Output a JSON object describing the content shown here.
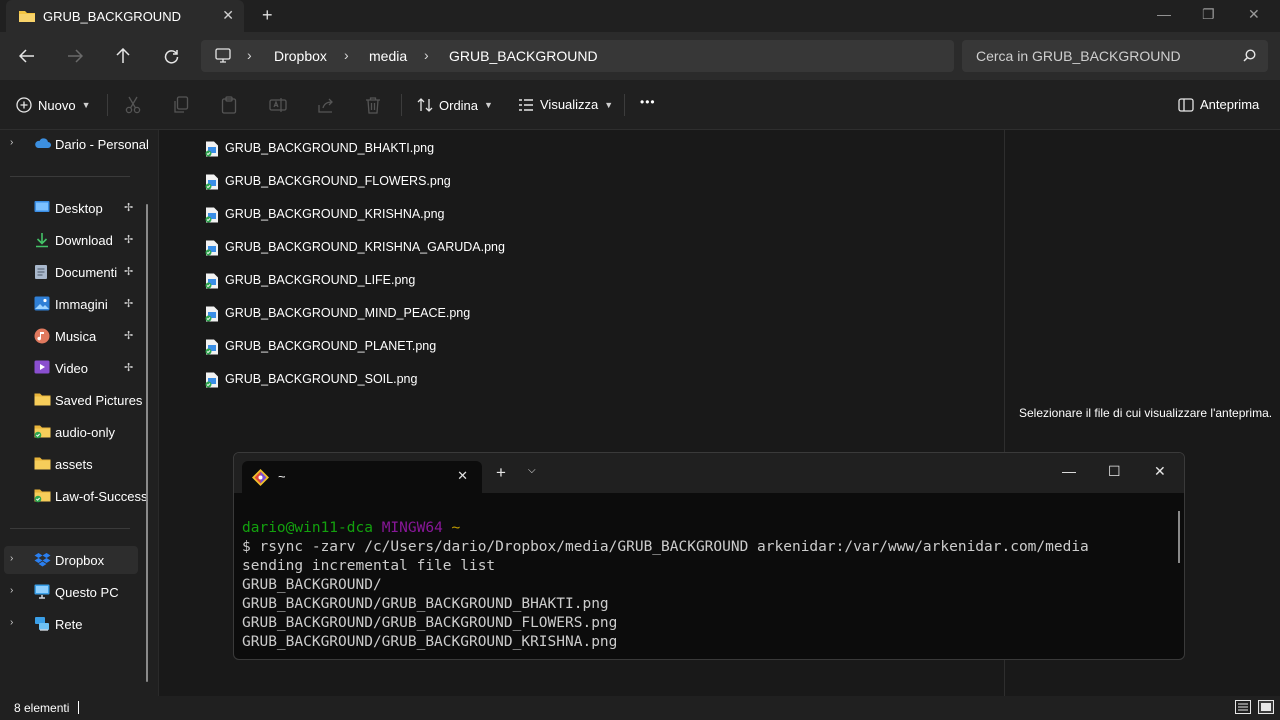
{
  "window": {
    "tab_title": "GRUB_BACKGROUND",
    "tab_close": "✕",
    "new_tab": "+",
    "minimize": "—",
    "restore": "❐",
    "close": "✕"
  },
  "address_bar": {
    "crumbs": [
      "Dropbox",
      "media",
      "GRUB_BACKGROUND"
    ],
    "separator": "›",
    "search_placeholder": "Cerca in GRUB_BACKGROUND"
  },
  "command_bar": {
    "new_label": "Nuovo",
    "sort_label": "Ordina",
    "view_label": "Visualizza",
    "more_label": "•••",
    "preview_label": "Anteprima"
  },
  "sidebar": {
    "top_item": {
      "label": "Dario - Personal",
      "icon": "onedrive-icon"
    },
    "quick_access": [
      {
        "label": "Desktop",
        "icon": "desktop-icon",
        "pinned": true
      },
      {
        "label": "Download",
        "icon": "download-icon",
        "pinned": true
      },
      {
        "label": "Documenti",
        "icon": "documents-icon",
        "pinned": true
      },
      {
        "label": "Immagini",
        "icon": "pictures-icon",
        "pinned": true
      },
      {
        "label": "Musica",
        "icon": "music-icon",
        "pinned": true
      },
      {
        "label": "Video",
        "icon": "video-icon",
        "pinned": true
      },
      {
        "label": "Saved Pictures",
        "icon": "folder-icon",
        "pinned": false
      },
      {
        "label": "audio-only",
        "icon": "folder-synced-icon",
        "pinned": false
      },
      {
        "label": "assets",
        "icon": "folder-icon",
        "pinned": false
      },
      {
        "label": "Law-of-Success",
        "icon": "folder-synced-icon",
        "pinned": false
      }
    ],
    "locations": [
      {
        "label": "Dropbox",
        "icon": "dropbox-icon",
        "selected": true
      },
      {
        "label": "Questo PC",
        "icon": "pc-icon",
        "selected": false
      },
      {
        "label": "Rete",
        "icon": "network-icon",
        "selected": false
      }
    ],
    "pin_glyph": "📌",
    "expander_glyph": "›"
  },
  "files": [
    "GRUB_BACKGROUND_BHAKTI.png",
    "GRUB_BACKGROUND_FLOWERS.png",
    "GRUB_BACKGROUND_KRISHNA.png",
    "GRUB_BACKGROUND_KRISHNA_GARUDA.png",
    "GRUB_BACKGROUND_LIFE.png",
    "GRUB_BACKGROUND_MIND_PEACE.png",
    "GRUB_BACKGROUND_PLANET.png",
    "GRUB_BACKGROUND_SOIL.png"
  ],
  "preview_pane": {
    "message": "Selezionare il file di cui visualizzare l'anteprima."
  },
  "status_bar": {
    "item_count": "8 elementi"
  },
  "terminal": {
    "tab_title": "~",
    "close": "✕",
    "plus": "+",
    "dropdown": "⌵",
    "minimize": "—",
    "maximize": "☐",
    "window_close": "✕",
    "prompt_user": "dario@win11-dca",
    "prompt_system": "MINGW64",
    "prompt_path": "~",
    "command": "$ rsync -zarv /c/Users/dario/Dropbox/media/GRUB_BACKGROUND arkenidar:/var/www/arkenidar.com/media",
    "output": [
      "sending incremental file list",
      "GRUB_BACKGROUND/",
      "GRUB_BACKGROUND/GRUB_BACKGROUND_BHAKTI.png",
      "GRUB_BACKGROUND/GRUB_BACKGROUND_FLOWERS.png",
      "GRUB_BACKGROUND/GRUB_BACKGROUND_KRISHNA.png"
    ]
  },
  "colors": {
    "folder": "#f4c542",
    "accent_blue": "#4a9df8",
    "term_green": "#13a10e",
    "term_purple": "#881798",
    "term_yellow": "#c19c00"
  }
}
